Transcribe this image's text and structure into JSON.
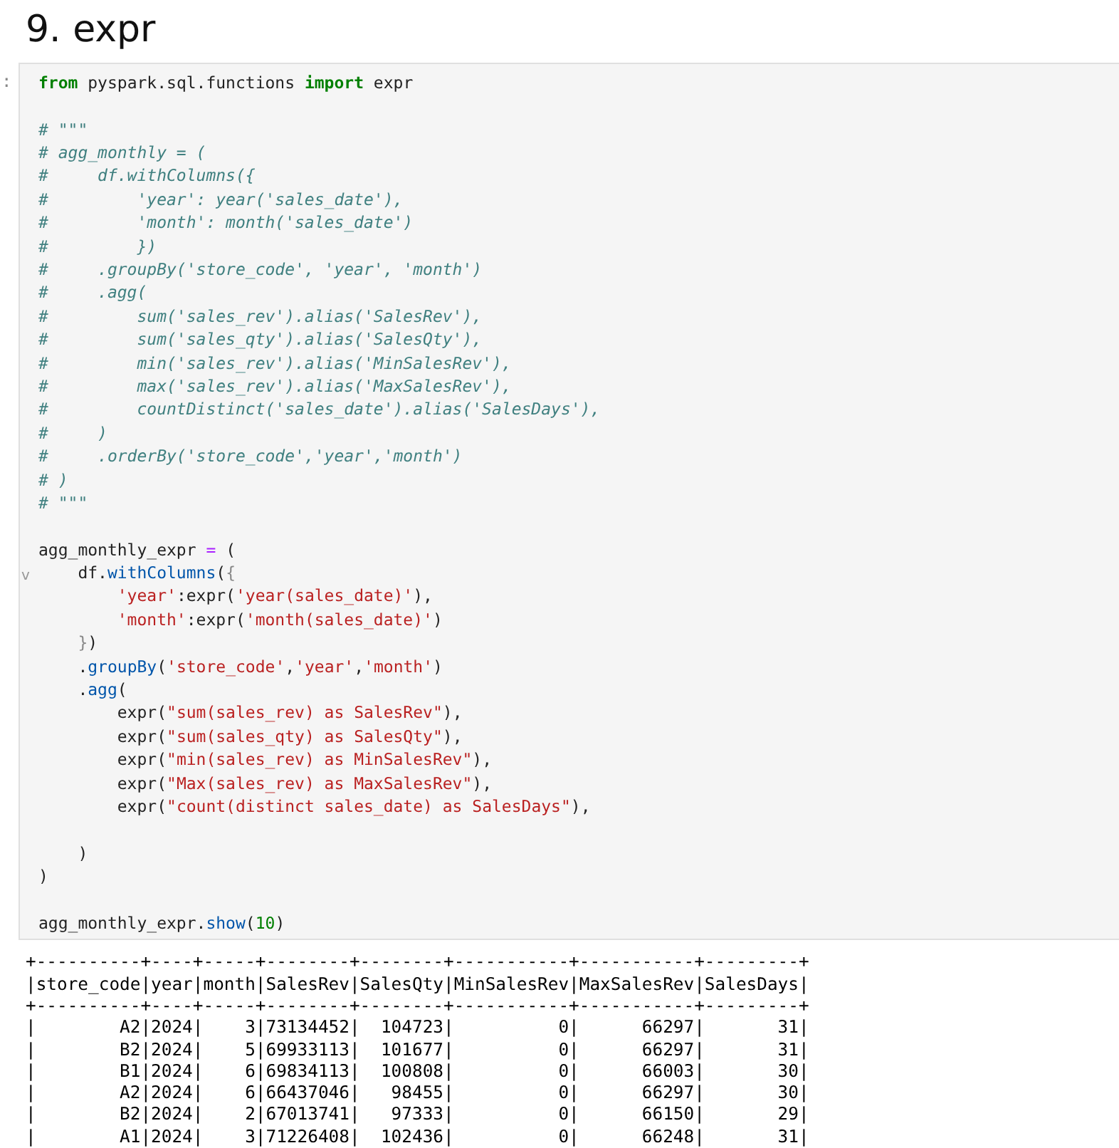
{
  "heading": "9. expr",
  "cell": {
    "prompt": ":",
    "collapse_marker": "v",
    "lines": [
      {
        "kind": "code",
        "tokens": [
          {
            "kind": "kw",
            "text": "from"
          },
          {
            "kind": "p",
            "text": " pyspark.sql.functions "
          },
          {
            "kind": "kw",
            "text": "import"
          },
          {
            "kind": "p",
            "text": " expr"
          }
        ]
      },
      {
        "kind": "blank"
      },
      {
        "kind": "code",
        "tokens": [
          {
            "kind": "c",
            "text": "# \"\"\""
          }
        ]
      },
      {
        "kind": "code",
        "tokens": [
          {
            "kind": "c",
            "text": "# agg_monthly = ("
          }
        ]
      },
      {
        "kind": "code",
        "tokens": [
          {
            "kind": "c",
            "text": "#     df.withColumns({"
          }
        ]
      },
      {
        "kind": "code",
        "tokens": [
          {
            "kind": "c",
            "text": "#         'year': year('sales_date'),"
          }
        ]
      },
      {
        "kind": "code",
        "tokens": [
          {
            "kind": "c",
            "text": "#         'month': month('sales_date')"
          }
        ]
      },
      {
        "kind": "code",
        "tokens": [
          {
            "kind": "c",
            "text": "#         })"
          }
        ]
      },
      {
        "kind": "code",
        "tokens": [
          {
            "kind": "c",
            "text": "#     .groupBy('store_code', 'year', 'month')"
          }
        ]
      },
      {
        "kind": "code",
        "tokens": [
          {
            "kind": "c",
            "text": "#     .agg("
          }
        ]
      },
      {
        "kind": "code",
        "tokens": [
          {
            "kind": "c",
            "text": "#         sum('sales_rev').alias('SalesRev'),"
          }
        ]
      },
      {
        "kind": "code",
        "tokens": [
          {
            "kind": "c",
            "text": "#         sum('sales_qty').alias('SalesQty'),"
          }
        ]
      },
      {
        "kind": "code",
        "tokens": [
          {
            "kind": "c",
            "text": "#         min('sales_rev').alias('MinSalesRev'),"
          }
        ]
      },
      {
        "kind": "code",
        "tokens": [
          {
            "kind": "c",
            "text": "#         max('sales_rev').alias('MaxSalesRev'),"
          }
        ]
      },
      {
        "kind": "code",
        "tokens": [
          {
            "kind": "c",
            "text": "#         countDistinct('sales_date').alias('SalesDays'),"
          }
        ]
      },
      {
        "kind": "code",
        "tokens": [
          {
            "kind": "c",
            "text": "#     )"
          }
        ]
      },
      {
        "kind": "code",
        "tokens": [
          {
            "kind": "c",
            "text": "#     .orderBy('store_code','year','month')"
          }
        ]
      },
      {
        "kind": "code",
        "tokens": [
          {
            "kind": "c",
            "text": "# )"
          }
        ]
      },
      {
        "kind": "code",
        "tokens": [
          {
            "kind": "c",
            "text": "# \"\"\""
          }
        ]
      },
      {
        "kind": "blank"
      },
      {
        "kind": "code",
        "tokens": [
          {
            "kind": "p",
            "text": "agg_monthly_expr "
          },
          {
            "kind": "o",
            "text": "="
          },
          {
            "kind": "p",
            "text": " ("
          }
        ]
      },
      {
        "kind": "code",
        "tokens": [
          {
            "kind": "p",
            "text": "    df."
          },
          {
            "kind": "m",
            "text": "withColumns"
          },
          {
            "kind": "p",
            "text": "("
          },
          {
            "kind": "g",
            "text": "{"
          }
        ]
      },
      {
        "kind": "code",
        "tokens": [
          {
            "kind": "s",
            "text": "        'year'"
          },
          {
            "kind": "p",
            "text": ":expr("
          },
          {
            "kind": "s",
            "text": "'year(sales_date)'"
          },
          {
            "kind": "p",
            "text": "),"
          }
        ]
      },
      {
        "kind": "code",
        "tokens": [
          {
            "kind": "s",
            "text": "        'month'"
          },
          {
            "kind": "p",
            "text": ":expr("
          },
          {
            "kind": "s",
            "text": "'month(sales_date)'"
          },
          {
            "kind": "p",
            "text": ")"
          }
        ]
      },
      {
        "kind": "code",
        "tokens": [
          {
            "kind": "g",
            "text": "    }"
          },
          {
            "kind": "p",
            "text": ")"
          }
        ]
      },
      {
        "kind": "code",
        "tokens": [
          {
            "kind": "p",
            "text": "    ."
          },
          {
            "kind": "m",
            "text": "groupBy"
          },
          {
            "kind": "p",
            "text": "("
          },
          {
            "kind": "s",
            "text": "'store_code'"
          },
          {
            "kind": "p",
            "text": ","
          },
          {
            "kind": "s",
            "text": "'year'"
          },
          {
            "kind": "p",
            "text": ","
          },
          {
            "kind": "s",
            "text": "'month'"
          },
          {
            "kind": "p",
            "text": ")"
          }
        ]
      },
      {
        "kind": "code",
        "tokens": [
          {
            "kind": "p",
            "text": "    ."
          },
          {
            "kind": "m",
            "text": "agg"
          },
          {
            "kind": "p",
            "text": "("
          }
        ]
      },
      {
        "kind": "code",
        "tokens": [
          {
            "kind": "p",
            "text": "        expr("
          },
          {
            "kind": "s",
            "text": "\"sum(sales_rev) as SalesRev\""
          },
          {
            "kind": "p",
            "text": "),"
          }
        ]
      },
      {
        "kind": "code",
        "tokens": [
          {
            "kind": "p",
            "text": "        expr("
          },
          {
            "kind": "s",
            "text": "\"sum(sales_qty) as SalesQty\""
          },
          {
            "kind": "p",
            "text": "),"
          }
        ]
      },
      {
        "kind": "code",
        "tokens": [
          {
            "kind": "p",
            "text": "        expr("
          },
          {
            "kind": "s",
            "text": "\"min(sales_rev) as MinSalesRev\""
          },
          {
            "kind": "p",
            "text": "),"
          }
        ]
      },
      {
        "kind": "code",
        "tokens": [
          {
            "kind": "p",
            "text": "        expr("
          },
          {
            "kind": "s",
            "text": "\"Max(sales_rev) as MaxSalesRev\""
          },
          {
            "kind": "p",
            "text": "),"
          }
        ]
      },
      {
        "kind": "code",
        "tokens": [
          {
            "kind": "p",
            "text": "        expr("
          },
          {
            "kind": "s",
            "text": "\"count(distinct sales_date) as SalesDays\""
          },
          {
            "kind": "p",
            "text": "),"
          }
        ]
      },
      {
        "kind": "blank"
      },
      {
        "kind": "code",
        "tokens": [
          {
            "kind": "p",
            "text": "    )"
          }
        ]
      },
      {
        "kind": "code",
        "tokens": [
          {
            "kind": "p",
            "text": ")"
          }
        ]
      },
      {
        "kind": "blank"
      },
      {
        "kind": "code",
        "tokens": [
          {
            "kind": "p",
            "text": "agg_monthly_expr."
          },
          {
            "kind": "m",
            "text": "show"
          },
          {
            "kind": "p",
            "text": "("
          },
          {
            "kind": "n",
            "text": "10"
          },
          {
            "kind": "p",
            "text": ")"
          }
        ]
      }
    ]
  },
  "output": {
    "lines": [
      "+----------+----+-----+--------+--------+-----------+-----------+---------+",
      "|store_code|year|month|SalesRev|SalesQty|MinSalesRev|MaxSalesRev|SalesDays|",
      "+----------+----+-----+--------+--------+-----------+-----------+---------+",
      "|        A2|2024|    3|73134452|  104723|          0|      66297|       31|",
      "|        B2|2024|    5|69933113|  101677|          0|      66297|       31|",
      "|        B1|2024|    6|69834113|  100808|          0|      66003|       30|",
      "|        A2|2024|    6|66437046|   98455|          0|      66297|       30|",
      "|        B2|2024|    2|67013741|   97333|          0|      66150|       29|",
      "|        A1|2024|    3|71226408|  102436|          0|      66248|       31|"
    ]
  }
}
